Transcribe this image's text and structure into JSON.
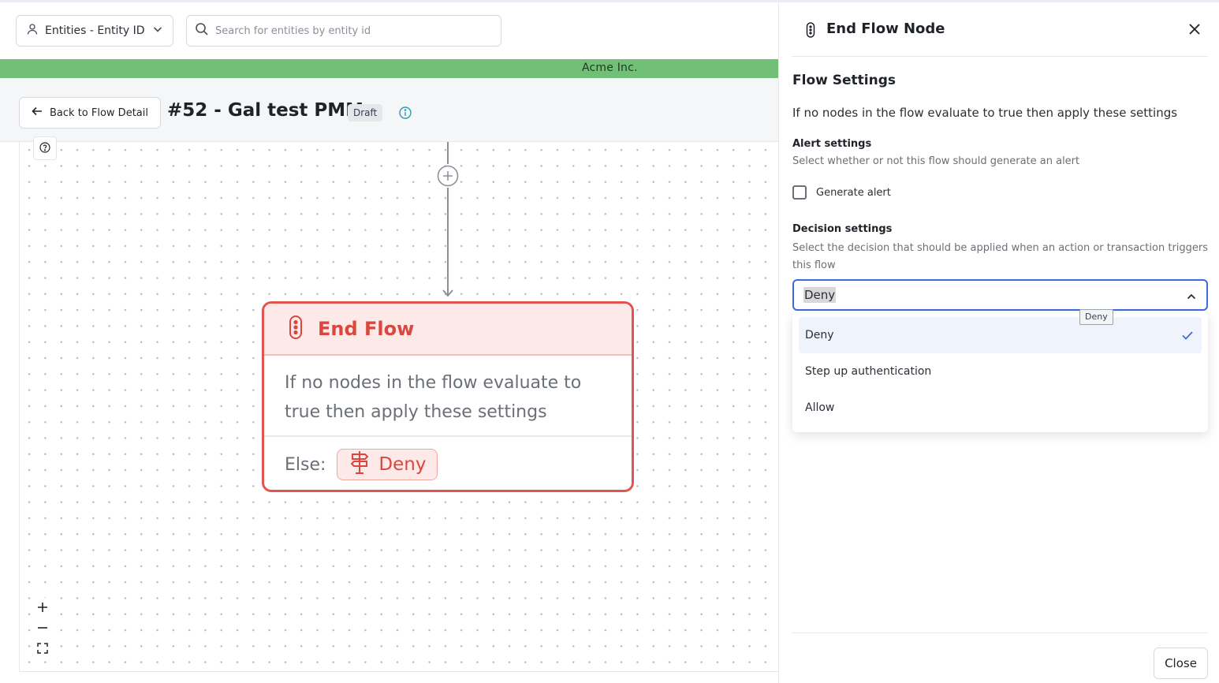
{
  "topbar": {
    "entity_select_label": "Entities - Entity ID",
    "search_placeholder": "Search for entities by entity id"
  },
  "org_banner": "Acme Inc.",
  "header": {
    "back_label": "Back to Flow Detail",
    "flow_title": "#52 - Gal test PMM",
    "status_badge": "Draft"
  },
  "node": {
    "title": "End Flow",
    "description": "If no nodes in the flow evaluate to true then apply these settings",
    "else_label": "Else:",
    "decision": "Deny"
  },
  "zoom_controls": {
    "zoom_in": "+",
    "zoom_out": "–"
  },
  "panel": {
    "title": "End Flow Node",
    "section_title": "Flow Settings",
    "section_description": "If no nodes in the flow evaluate to true then apply these settings",
    "alert_heading": "Alert settings",
    "alert_subtext": "Select whether or not this flow should generate an alert",
    "generate_alert_label": "Generate alert",
    "generate_alert_checked": false,
    "decision_heading": "Decision settings",
    "decision_subtext": "Select the decision that should be applied when an action or transaction triggers this flow",
    "decision_value": "Deny",
    "tooltip": "Deny",
    "options": [
      "Deny",
      "Step up authentication",
      "Allow"
    ],
    "selected_option": "Deny",
    "close_label": "Close"
  },
  "colors": {
    "accent_red": "#e2544f",
    "banner_green": "#72bf78",
    "focus_blue": "#3d6bd9"
  },
  "icons": [
    "user-icon",
    "chevron-down-icon",
    "search-icon",
    "arrow-left-icon",
    "info-icon",
    "help-icon",
    "plus-circle-icon",
    "traffic-light-icon",
    "signpost-icon",
    "zoom-in-icon",
    "zoom-out-icon",
    "fit-view-icon",
    "close-icon",
    "chevron-up-icon",
    "check-icon"
  ]
}
